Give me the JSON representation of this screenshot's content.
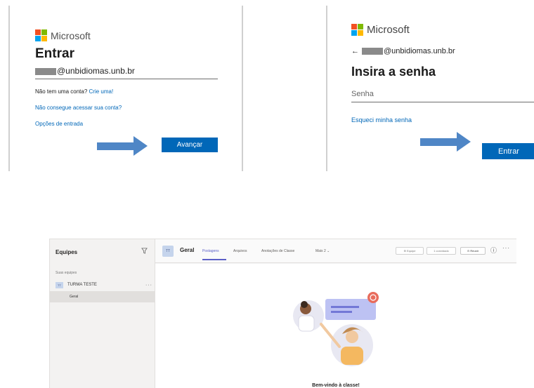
{
  "left_panel": {
    "brand": "Microsoft",
    "title": "Entrar",
    "email_suffix": "@unbidiomas.unb.br",
    "no_account_text": "Não tem uma conta?",
    "create_link": "Crie uma!",
    "cant_access_link": "Não consegue acessar sua conta?",
    "signin_options_link": "Opções de entrada",
    "next_button": "Avançar"
  },
  "right_panel": {
    "brand": "Microsoft",
    "back_arrow": "←",
    "email_suffix": "@unbidiomas.unb.br",
    "title": "Insira a senha",
    "password_placeholder": "Senha",
    "forgot_link": "Esqueci minha senha",
    "signin_button": "Entrar"
  },
  "teams": {
    "sidebar": {
      "heading": "Equipes",
      "filter_icon": "filter-icon",
      "section_label": "Suas equipes",
      "team_avatar": "TT",
      "team_name": "TURMA TESTE",
      "team_more": "···",
      "channel": "Geral"
    },
    "header": {
      "avatar": "TT",
      "channel_title": "Geral",
      "tabs": [
        "Postagens",
        "Arquivos",
        "Anotações de Classe",
        "Mais 2 ⌄"
      ],
      "team_button": "⊕ Equipe",
      "guest_button": "1 convidado",
      "meet_button": "⊙ Reunir",
      "info_icon": "ⓘ",
      "more_icon": "···"
    },
    "welcome_text": "Bem-vindo à classe!"
  },
  "colors": {
    "ms_red": "#f25022",
    "ms_green": "#7fba00",
    "ms_blue": "#00a4ef",
    "ms_yellow": "#ffb900",
    "primary_blue": "#0067b8",
    "arrow_blue": "#4f86c6",
    "teams_purple": "#5b5fc7"
  }
}
